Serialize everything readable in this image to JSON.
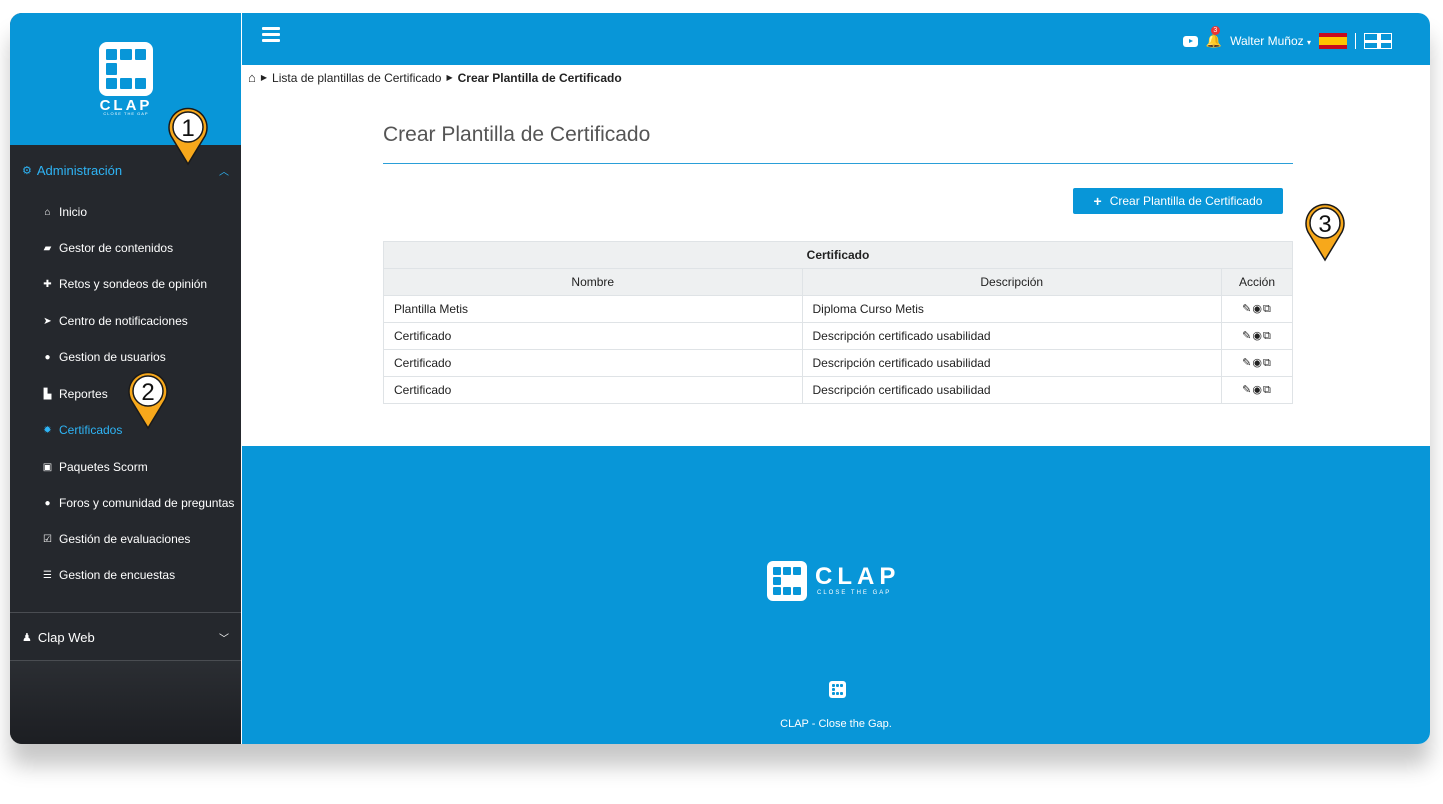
{
  "brand": {
    "name": "CLAP",
    "tagline": "CLOSE THE GAP"
  },
  "sidebar": {
    "group_admin": {
      "label": "Administración",
      "icon": "cogs-icon"
    },
    "items": [
      {
        "label": "Inicio",
        "icon": "home-icon"
      },
      {
        "label": "Gestor de contenidos",
        "icon": "book-icon"
      },
      {
        "label": "Retos y sondeos de opinión",
        "icon": "puzzle-icon"
      },
      {
        "label": "Centro de notificaciones",
        "icon": "paper-plane-icon"
      },
      {
        "label": "Gestion de usuarios",
        "icon": "users-icon"
      },
      {
        "label": "Reportes",
        "icon": "chart-icon"
      },
      {
        "label": "Certificados",
        "icon": "certificate-icon"
      },
      {
        "label": "Paquetes Scorm",
        "icon": "archive-icon"
      },
      {
        "label": "Foros y comunidad de preguntas",
        "icon": "comments-icon"
      },
      {
        "label": "Gestión de evaluaciones",
        "icon": "checkbox-icon"
      },
      {
        "label": "Gestion de encuestas",
        "icon": "list-icon"
      }
    ],
    "group_web": {
      "label": "Clap Web",
      "icon": "user-icon"
    }
  },
  "topbar": {
    "user_name": "Walter Muñoz",
    "notification_count": "3"
  },
  "breadcrumb": {
    "parent": "Lista de plantillas de Certificado",
    "current": "Crear Plantilla de Certificado"
  },
  "main": {
    "title": "Crear Plantilla de Certificado",
    "create_button": "Crear Plantilla de Certificado",
    "table": {
      "caption": "Certificado",
      "headers": [
        "Nombre",
        "Descripción",
        "Acción"
      ],
      "rows": [
        {
          "nombre": "Plantilla Metis",
          "descripcion": "Diploma Curso Metis"
        },
        {
          "nombre": "Certificado",
          "descripcion": "Descripción certificado usabilidad"
        },
        {
          "nombre": "Certificado",
          "descripcion": "Descripción certificado usabilidad"
        },
        {
          "nombre": "Certificado",
          "descripcion": "Descripción certificado usabilidad"
        }
      ]
    }
  },
  "footer": {
    "copyright": "CLAP - Close the Gap."
  },
  "markers": [
    "1",
    "2",
    "3"
  ],
  "colors": {
    "brand_blue": "#0896d8",
    "sidebar_dark": "#25282d",
    "active_link": "#2eb4f5",
    "marker_orange": "#f7a81b"
  }
}
